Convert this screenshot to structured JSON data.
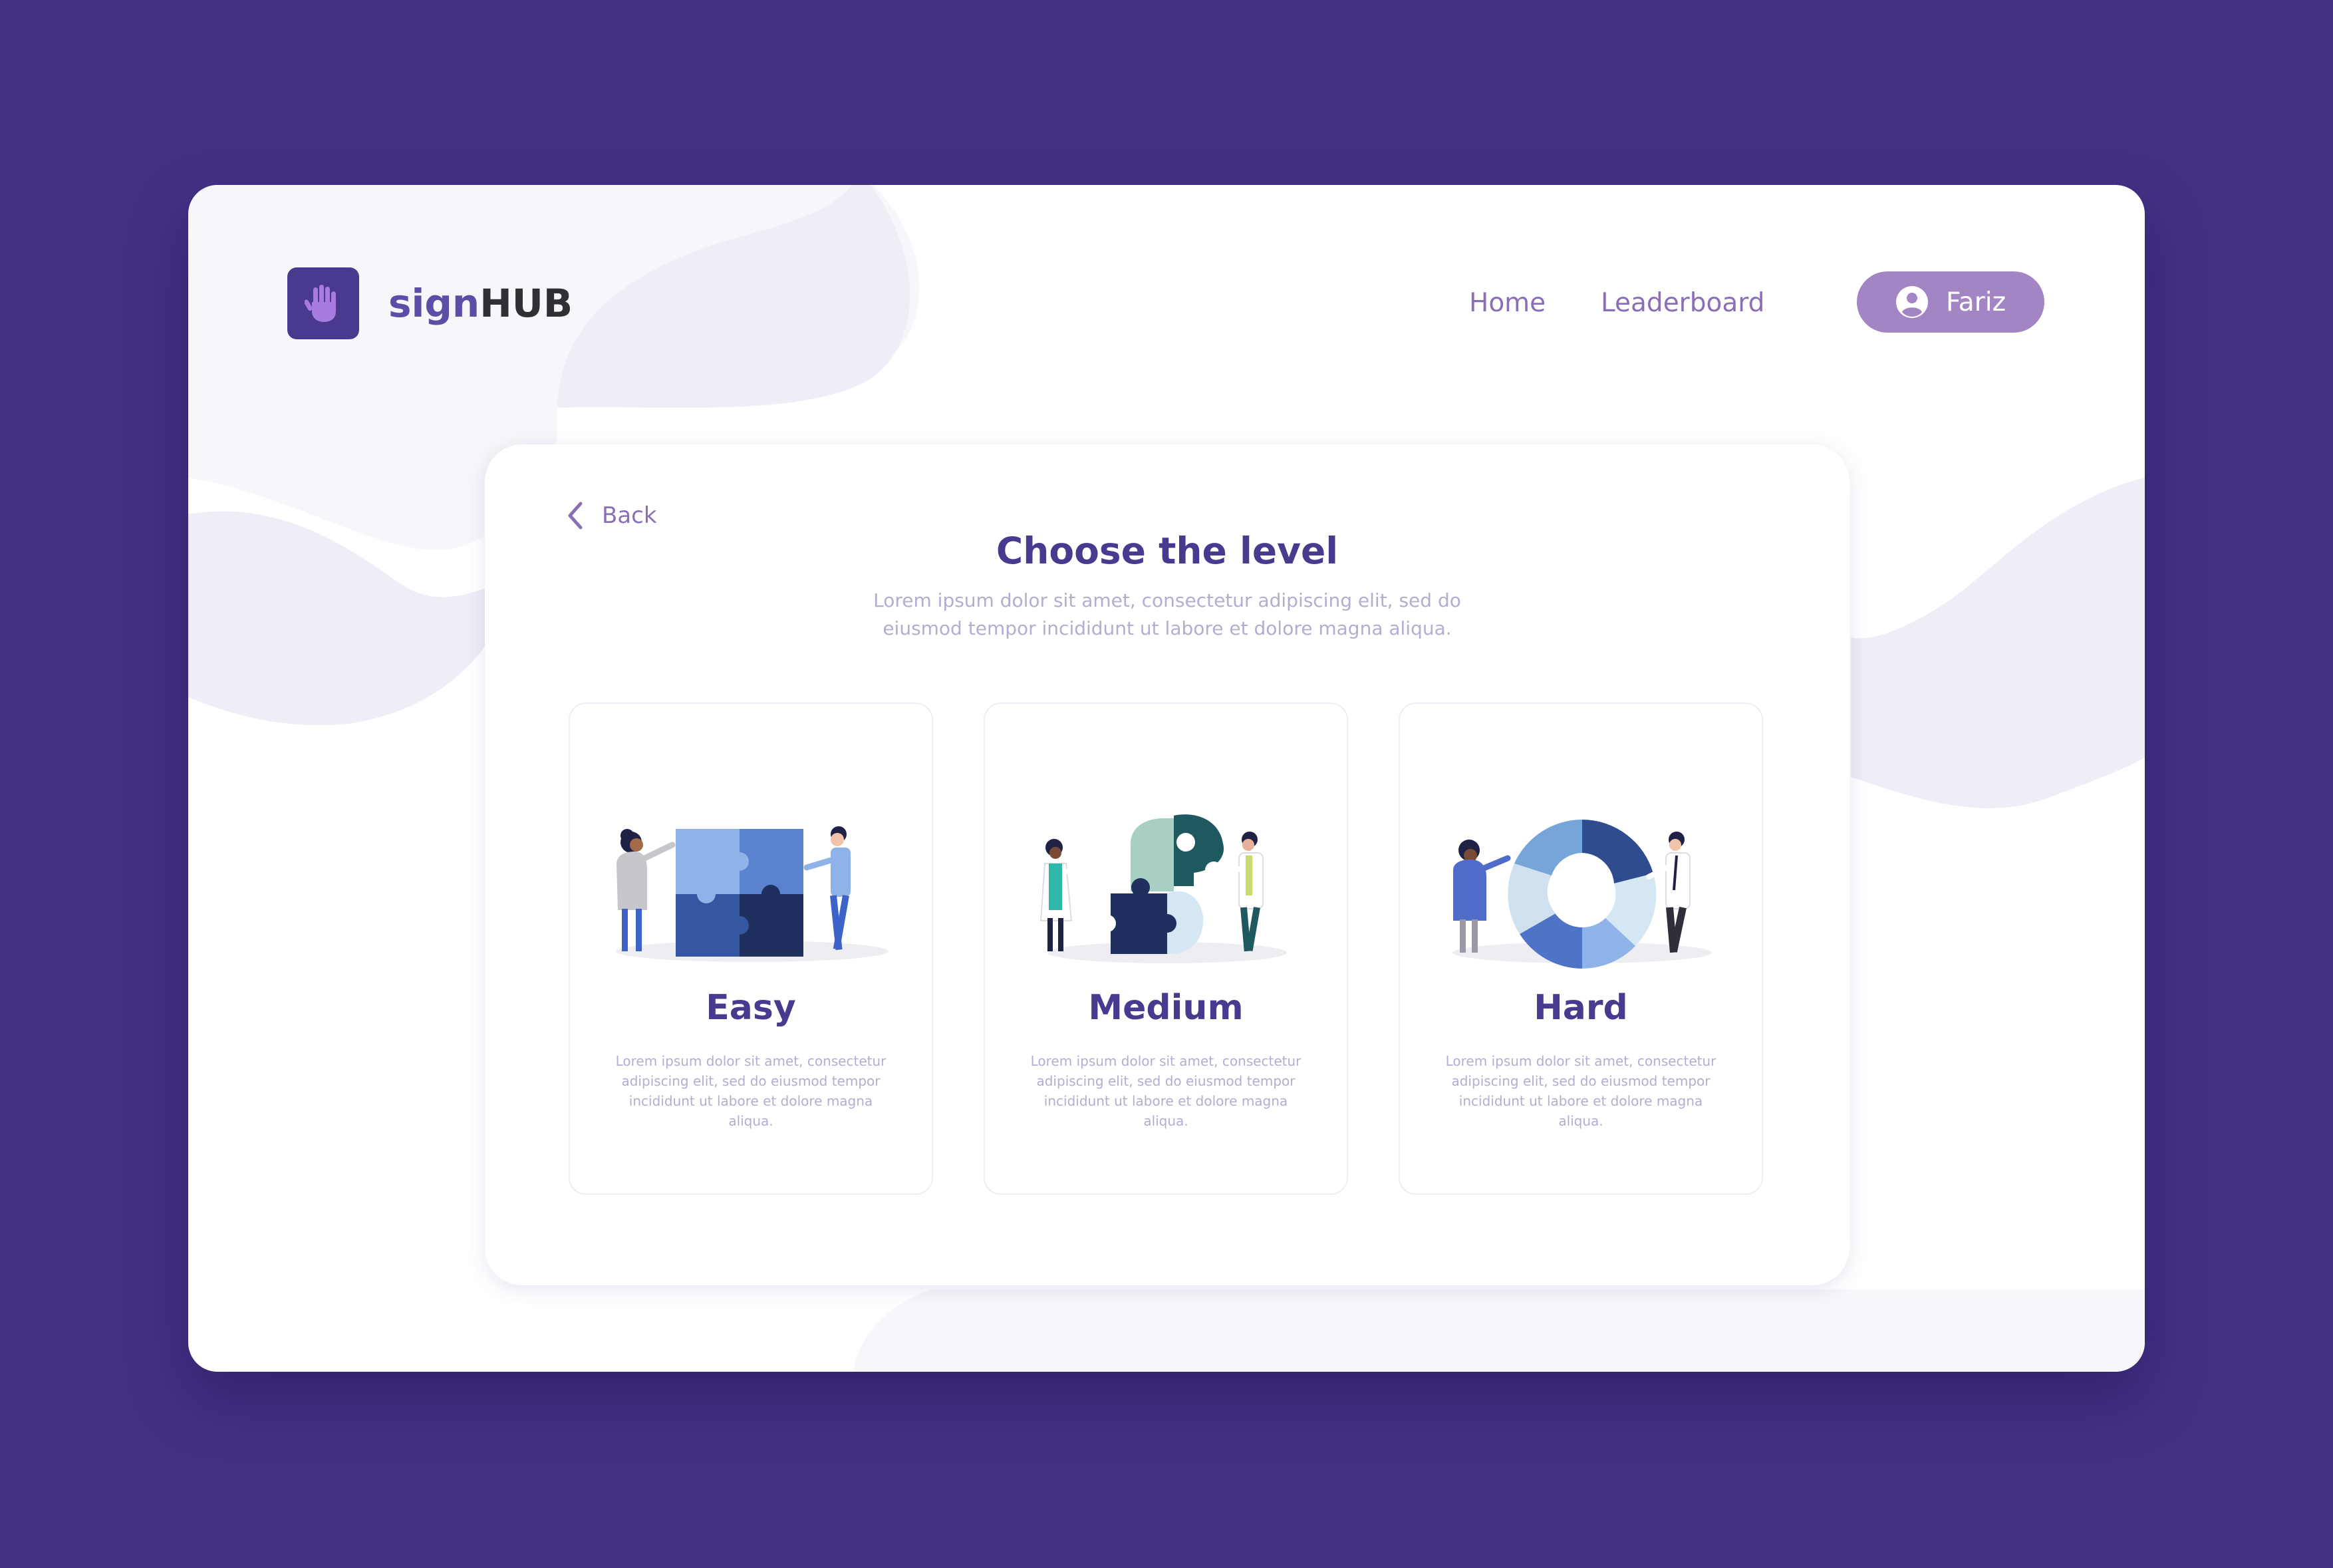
{
  "brand": {
    "name_part1": "sign",
    "name_part2": "HUB",
    "logo_icon": "hand-icon"
  },
  "nav": {
    "home": "Home",
    "leaderboard": "Leaderboard"
  },
  "user": {
    "name": "Fariz",
    "icon": "user-circle-icon"
  },
  "panel": {
    "back_label": "Back",
    "title": "Choose the level",
    "subtitle": "Lorem ipsum dolor sit amet, consectetur adipiscing elit, sed do eiusmod tempor incididunt ut labore et dolore magna aliqua."
  },
  "levels": [
    {
      "title": "Easy",
      "description": "Lorem ipsum dolor sit amet, consectetur adipiscing elit, sed do eiusmod tempor incididunt ut labore et dolore magna aliqua.",
      "illustration": "puzzle-square-illustration"
    },
    {
      "title": "Medium",
      "description": "Lorem ipsum dolor sit amet, consectetur adipiscing elit, sed do eiusmod tempor incididunt ut labore et dolore magna aliqua.",
      "illustration": "puzzle-pieces-illustration"
    },
    {
      "title": "Hard",
      "description": "Lorem ipsum dolor sit amet, consectetur adipiscing elit, sed do eiusmod tempor incididunt ut labore et dolore magna aliqua.",
      "illustration": "puzzle-ring-illustration"
    }
  ],
  "colors": {
    "background": "#433186",
    "brand_purple": "#4a3a8f",
    "accent_lilac": "#a385c4",
    "nav_text": "#8a6fb8",
    "muted_text": "#b5acd0",
    "blob": "#efedf6"
  }
}
